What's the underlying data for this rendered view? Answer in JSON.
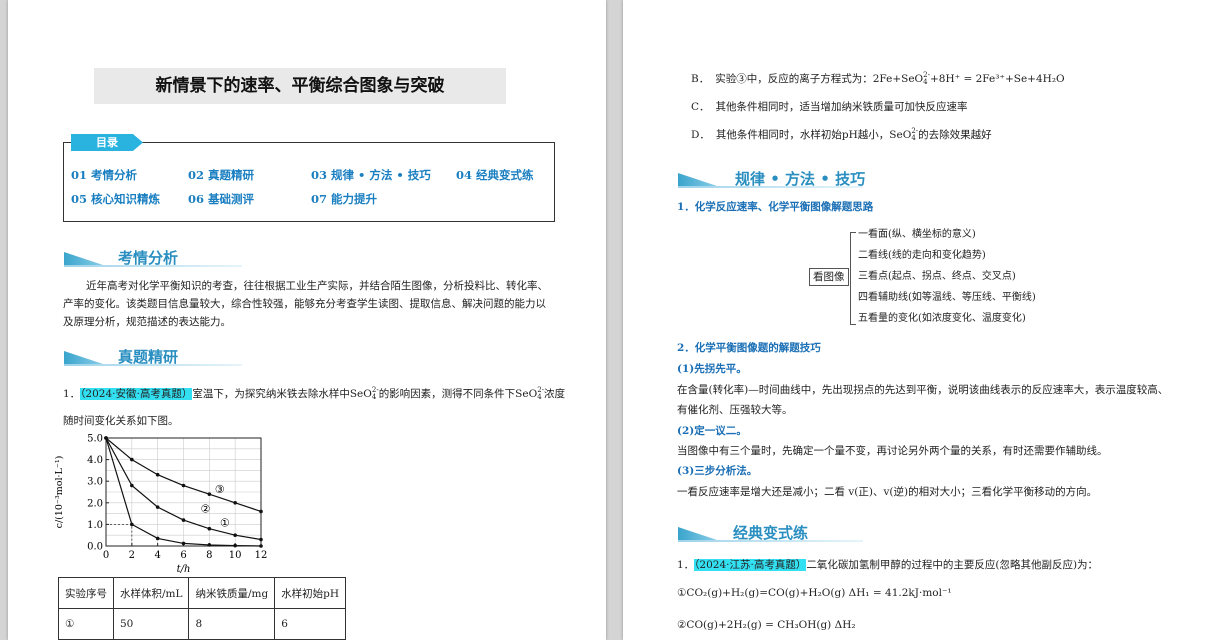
{
  "left_page": {
    "title": "新情景下的速率、平衡综合图象与突破",
    "toc": {
      "tab": "目录",
      "items": [
        "01 考情分析",
        "02 真题精研",
        "03 规律 • 方法 • 技巧",
        "04 经典变式练",
        "05 核心知识精炼",
        "06 基础测评",
        "07 能力提升"
      ]
    },
    "section1": {
      "title": "考情分析",
      "lines": [
        "近年高考对化学平衡知识的考查，往往根据工业生产实际，并结合陌生图像，分析投料比、转化率、",
        "产率的变化。该类题目信息量较大，综合性较强，能够充分考查学生读图、提取信息、解决问题的能力以",
        "及原理分析，规范描述的表达能力。"
      ]
    },
    "section2": {
      "title": "真题精研",
      "q_num": "1．",
      "q_tag": "（2024·安徽·高考真题）",
      "q_text1": "室温下，为探究纳米铁去除水样中SeO",
      "q_text1b": "的影响因素，测得不同条件下SeO",
      "q_text1c": "浓度",
      "ion_sub": "4",
      "ion_sup": "2-",
      "q_text2": "随时间变化关系如下图。"
    },
    "chart_data": {
      "type": "line",
      "x": [
        0,
        2,
        4,
        6,
        8,
        10,
        12
      ],
      "x_ticks": [
        "0",
        "2",
        "4",
        "6",
        "8",
        "10",
        "12"
      ],
      "y_ticks": [
        "0.0",
        "1.0",
        "2.0",
        "3.0",
        "4.0",
        "5.0"
      ],
      "xlabel": "t/h",
      "ylabel": "c/(10⁻³mol·L⁻¹)",
      "xlim": [
        0,
        12
      ],
      "ylim": [
        0,
        5
      ],
      "series": [
        {
          "name": "①",
          "values": [
            5.0,
            1.0,
            0.35,
            0.12,
            0.05,
            0.02,
            0.0
          ]
        },
        {
          "name": "②",
          "values": [
            5.0,
            2.8,
            1.8,
            1.2,
            0.8,
            0.5,
            0.3
          ]
        },
        {
          "name": "③",
          "values": [
            5.0,
            4.0,
            3.3,
            2.8,
            2.4,
            2.0,
            1.6
          ]
        }
      ],
      "annotation": "dashed guide from (0,1.0) to (2,1.0) down to x=2"
    },
    "table": {
      "headers": [
        "实验序号",
        "水样体积/mL",
        "纳米铁质量/mg",
        "水样初始pH"
      ],
      "rows": [
        [
          "①",
          "50",
          "8",
          "6"
        ]
      ]
    }
  },
  "right_page": {
    "options": [
      {
        "label": "B．",
        "text": "实验③中，反应的离子方程式为：2Fe+SeO",
        "tail": "+8H⁺ = 2Fe³⁺+Se+4H₂O"
      },
      {
        "label": "C．",
        "text": "其他条件相同时，适当增加纳米铁质量可加快反应速率",
        "tail": ""
      },
      {
        "label": "D．",
        "text": "其他条件相同时，水样初始pH越小，SeO",
        "tail": "的去除效果越好"
      }
    ],
    "section3": {
      "title": "规律 • 方法 • 技巧",
      "h1": "1．化学反应速率、化学平衡图像解题思路",
      "diagram_label": "看图像",
      "diagram_items": [
        "一看面(纵、横坐标的意义)",
        "二看线(线的走向和变化趋势)",
        "三看点(起点、拐点、终点、交叉点)",
        "四看辅助线(如等温线、等压线、平衡线)",
        "五看量的变化(如浓度变化、温度变化)"
      ],
      "h2": "2．化学平衡图像题的解题技巧",
      "t1": "(1)先拐先平。",
      "p1a": "在含量(转化率)—时间曲线中，先出现拐点的先达到平衡，说明该曲线表示的反应速率大，表示温度较高、",
      "p1b": "有催化剂、压强较大等。",
      "t2": "(2)定一议二。",
      "p2": "当图像中有三个量时，先确定一个量不变，再讨论另外两个量的关系，有时还需要作辅助线。",
      "t3": "(3)三步分析法。",
      "p3": "一看反应速率是增大还是减小；二看 v(正)、v(逆)的相对大小；三看化学平衡移动的方向。"
    },
    "section4": {
      "title": "经典变式练",
      "q_num": "1．",
      "q_tag": "（2024·江苏·高考真题）",
      "q_text": "二氧化碳加氢制甲醇的过程中的主要反应(忽略其他副反应)为：",
      "eq1": "①CO₂(g)+H₂(g)=CO(g)+H₂O(g)   ΔH₁ = 41.2kJ·mol⁻¹",
      "eq2": "②CO(g)+2H₂(g) = CH₃OH(g)   ΔH₂"
    }
  }
}
